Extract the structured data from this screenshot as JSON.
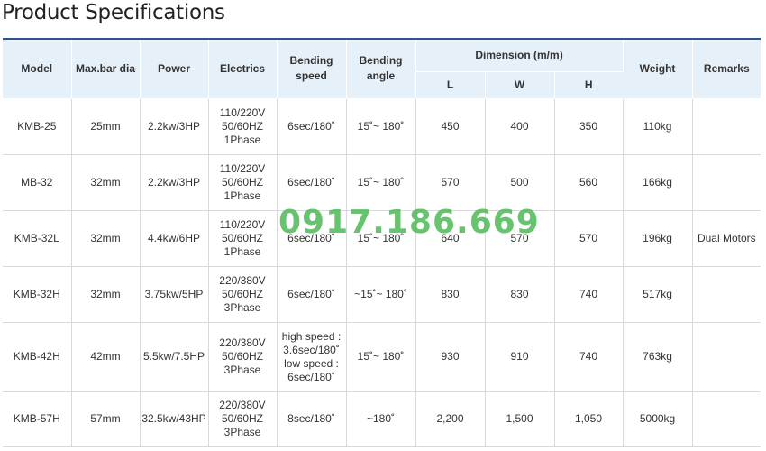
{
  "page": {
    "title": "Product Specifications"
  },
  "table": {
    "headers": {
      "model": "Model",
      "max_bar_dia": "Max.bar dia",
      "power": "Power",
      "electrics": "Electrics",
      "bending_speed": [
        "Bending",
        "speed"
      ],
      "bending_angle": [
        "Bending",
        "angle"
      ],
      "dimension": "Dimension (m/m)",
      "dim_l": "L",
      "dim_w": "W",
      "dim_h": "H",
      "weight": "Weight",
      "remarks": "Remarks"
    },
    "rows": [
      {
        "model": "KMB-25",
        "max_bar_dia": "25mm",
        "power": "2.2kw/3HP",
        "electrics": [
          "110/220V",
          "50/60HZ",
          "1Phase"
        ],
        "bending_speed": [
          "6sec/180˚"
        ],
        "bending_angle": "15˚~ 180˚",
        "l": "450",
        "w": "400",
        "h": "350",
        "weight": "110kg",
        "remarks": ""
      },
      {
        "model": "MB-32",
        "max_bar_dia": "32mm",
        "power": "2.2kw/3HP",
        "electrics": [
          "110/220V",
          "50/60HZ",
          "1Phase"
        ],
        "bending_speed": [
          "6sec/180˚"
        ],
        "bending_angle": "15˚~ 180˚",
        "l": "570",
        "w": "500",
        "h": "560",
        "weight": "166kg",
        "remarks": ""
      },
      {
        "model": "KMB-32L",
        "max_bar_dia": "32mm",
        "power": "4.4kw/6HP",
        "electrics": [
          "110/220V",
          "50/60HZ",
          "1Phase"
        ],
        "bending_speed": [
          "6sec/180˚"
        ],
        "bending_angle": "15˚~ 180˚",
        "l": "640",
        "w": "570",
        "h": "570",
        "weight": "196kg",
        "remarks": "Dual Motors"
      },
      {
        "model": "KMB-32H",
        "max_bar_dia": "32mm",
        "power": "3.75kw/5HP",
        "electrics": [
          "220/380V",
          "50/60HZ",
          "3Phase"
        ],
        "bending_speed": [
          "6sec/180˚"
        ],
        "bending_angle": "~15˚~ 180˚",
        "l": "830",
        "w": "830",
        "h": "740",
        "weight": "517kg",
        "remarks": ""
      },
      {
        "model": "KMB-42H",
        "max_bar_dia": "42mm",
        "power": "5.5kw/7.5HP",
        "electrics": [
          "220/380V",
          "50/60HZ",
          "3Phase"
        ],
        "bending_speed": [
          "high speed :",
          "3.6sec/180˚",
          "low speed :",
          "6sec/180˚"
        ],
        "bending_angle": "15˚~ 180˚",
        "l": "930",
        "w": "910",
        "h": "740",
        "weight": "763kg",
        "remarks": ""
      },
      {
        "model": "KMB-57H",
        "max_bar_dia": "57mm",
        "power": "32.5kw/43HP",
        "electrics": [
          "220/380V",
          "50/60HZ",
          "3Phase"
        ],
        "bending_speed": [
          "8sec/180˚"
        ],
        "bending_angle": "~180˚",
        "l": "2,200",
        "w": "1,500",
        "h": "1,050",
        "weight": "5000kg",
        "remarks": ""
      }
    ]
  },
  "watermark": {
    "text": "0917.186.669",
    "color": "#4cb854"
  }
}
